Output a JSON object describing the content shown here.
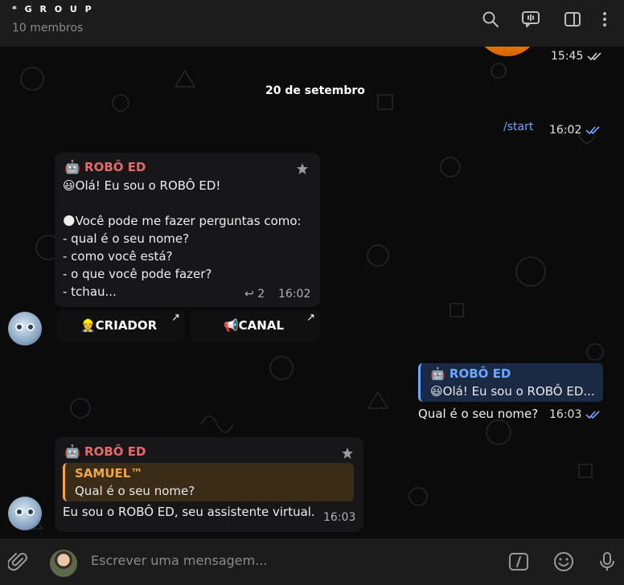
{
  "header": {
    "title": "* G R O U P",
    "subtitle": "10 membros"
  },
  "chat": {
    "date_separator": "20 de setembro",
    "top_message": {
      "time": "15:45"
    },
    "start_command": {
      "text": "/start",
      "time": "16:02"
    },
    "bot_welcome": {
      "author": "ROBÔ ED",
      "lines": [
        "😃Olá! Eu sou o ROBÔ ED!",
        "",
        "🌑Você pode me fazer perguntas como:",
        "- qual é o seu nome?",
        "- como você está?",
        "- o que você pode fazer?",
        "- tchau..."
      ],
      "replies_count": "2",
      "time": "16:02",
      "keyboard": [
        "👷CRIADOR",
        "📢CANAL"
      ]
    },
    "user_question": {
      "quote_author": "🤖 ROBÔ ED",
      "quote_text": "😃Olá! Eu sou o ROBÔ ED...",
      "text": "Qual é o seu nome?",
      "time": "16:03"
    },
    "bot_answer": {
      "author": "ROBÔ ED",
      "quote_author": "SAMUEL™",
      "quote_text": "Qual é o seu nome?",
      "text": "Eu sou o ROBÔ ED, seu assistente virtual.",
      "time": "16:03"
    }
  },
  "input": {
    "placeholder": "Escrever uma mensagem..."
  },
  "colors": {
    "bot_name": "#e06c6c",
    "link": "#6ea6ff",
    "read_ticks": "#6ea6ff",
    "quote_border": "#f0a64a"
  }
}
